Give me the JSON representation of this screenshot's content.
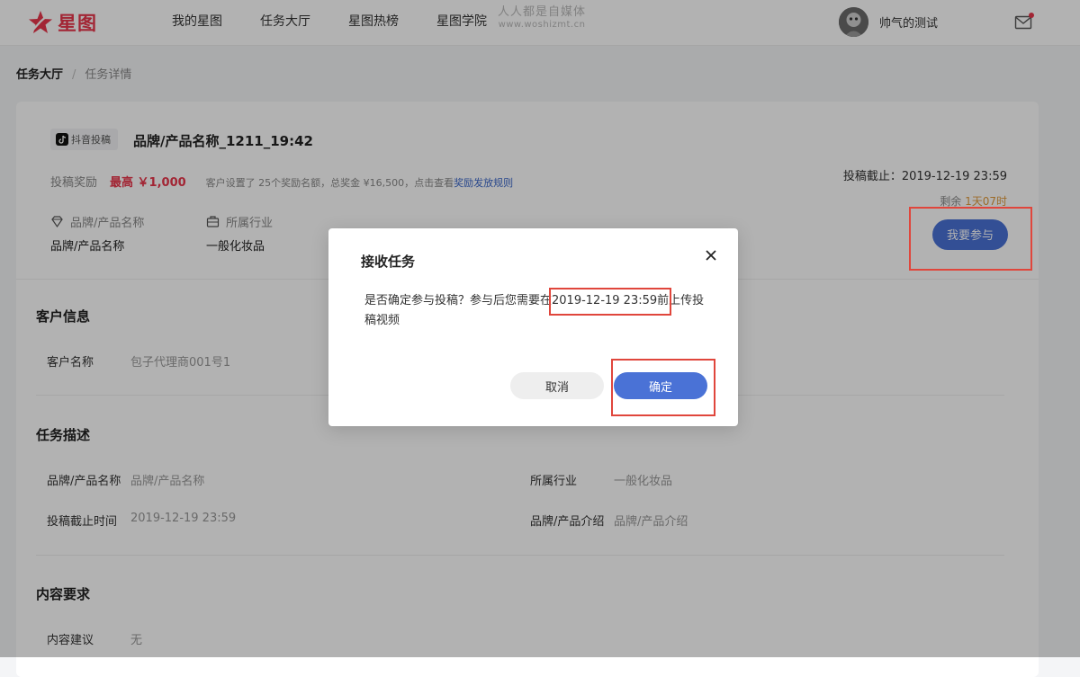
{
  "header": {
    "logo_text": "星图",
    "nav": [
      "我的星图",
      "任务大厅",
      "星图热榜",
      "星图学院"
    ],
    "watermark_main": "人人都是自媒体",
    "watermark_sub": "www.woshizmt.cn",
    "username": "帅气的测试"
  },
  "breadcrumb": {
    "current": "任务大厅",
    "separator": "/",
    "page": "任务详情"
  },
  "task": {
    "tag": "抖音投稿",
    "title": "品牌/产品名称_1211_19:42",
    "reward_label": "投稿奖励",
    "reward_value": "最高 ￥1,000",
    "reward_note": "客户设置了 25个奖励名额，总奖金 ¥16,500，点击查看",
    "reward_link": "奖励发放规则",
    "brand_label": "品牌/产品名称",
    "brand_value": "品牌/产品名称",
    "industry_label": "所属行业",
    "industry_value": "一般化妆品",
    "deadline": "投稿截止：2019-12-19 23:59",
    "remain_label": "剩余",
    "remain_value": "1天07时",
    "join_button": "我要参与"
  },
  "client_section": {
    "title": "客户信息",
    "name_label": "客户名称",
    "name_value": "包子代理商001号1"
  },
  "description_section": {
    "title": "任务描述",
    "brand_label": "品牌/产品名称",
    "brand_value": "品牌/产品名称",
    "industry_label": "所属行业",
    "industry_value": "一般化妆品",
    "deadline_label": "投稿截止时间",
    "deadline_value": "2019-12-19 23:59",
    "intro_label": "品牌/产品介绍",
    "intro_value": "品牌/产品介绍"
  },
  "content_section": {
    "title": "内容要求",
    "suggestion_label": "内容建议",
    "suggestion_value": "无"
  },
  "dialog": {
    "title": "接收任务",
    "body": "是否确定参与投稿？参与后您需要在2019-12-19 23:59前上传投稿视频",
    "cancel": "取消",
    "confirm": "确定"
  },
  "colors": {
    "brand_red": "#e8364b",
    "primary_blue": "#4a72d6",
    "annotation_red": "#e0463c",
    "remain_orange": "#e09a3c"
  },
  "icons": [
    "star-logo-icon",
    "mail-icon",
    "douyin-icon",
    "diamond-icon",
    "briefcase-icon",
    "close-icon"
  ]
}
